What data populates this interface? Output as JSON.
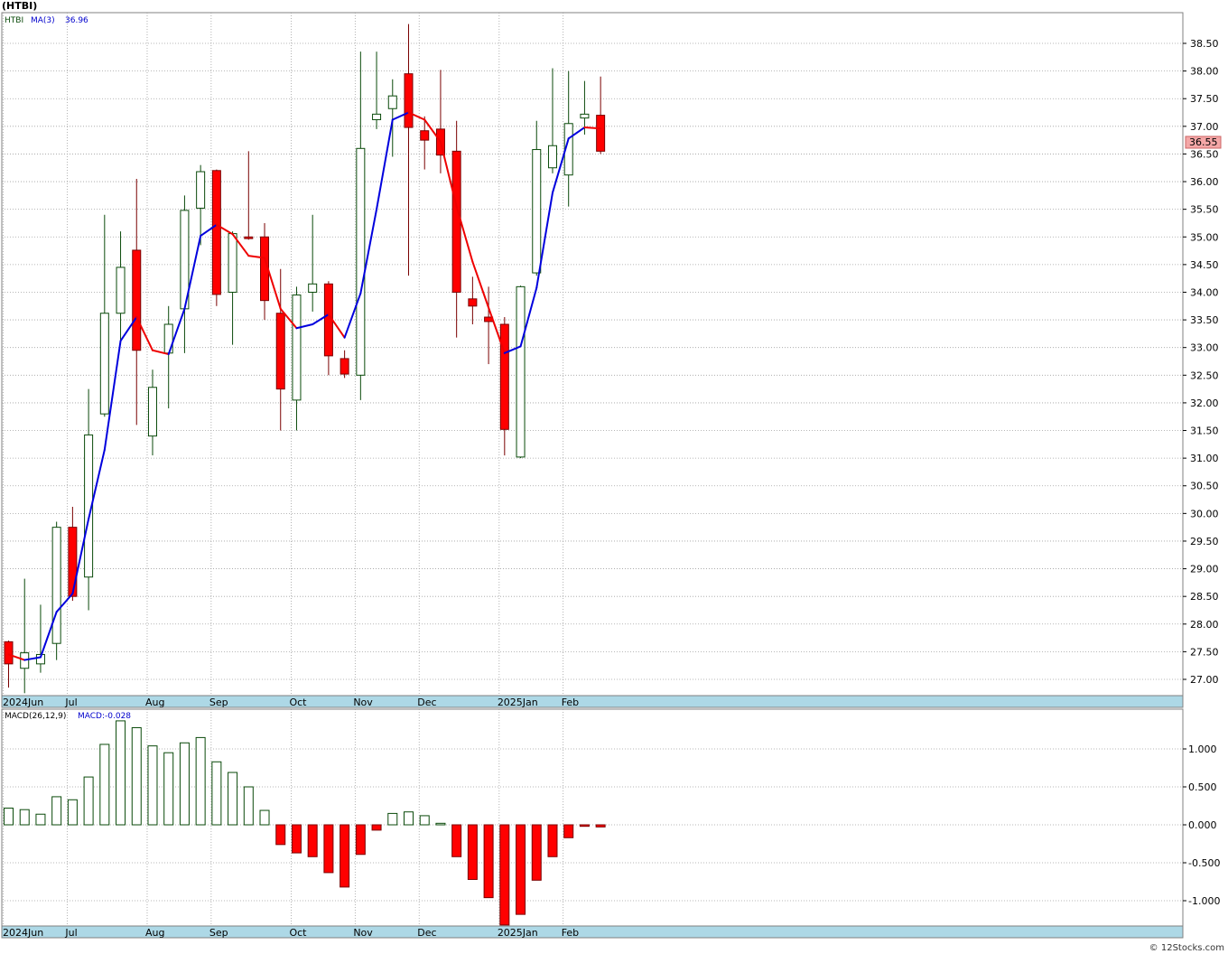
{
  "header": {
    "title": "(HTBI)"
  },
  "footer": {
    "credit": "© 12Stocks.com"
  },
  "colors": {
    "up_fill": "#ffffff",
    "up_stroke": "#0a4a0a",
    "down_fill": "#ff0000",
    "down_stroke": "#7a0000",
    "ma_up": "#0000dd",
    "ma_down": "#ee0000",
    "grid": "#a0a0a0",
    "axis_band": "#add8e6",
    "last_price_bg": "#f4a7a7"
  },
  "chart_data": [
    {
      "type": "candlestick",
      "title": "",
      "legend": {
        "symbol": "HTBI",
        "ma_label": "MA(3)",
        "ma_value": "36.96"
      },
      "y_ticks": [
        "27.00",
        "27.50",
        "28.00",
        "28.50",
        "29.00",
        "29.50",
        "30.00",
        "30.50",
        "31.00",
        "31.50",
        "32.00",
        "32.50",
        "33.00",
        "33.50",
        "34.00",
        "34.50",
        "35.00",
        "35.50",
        "36.00",
        "36.50",
        "37.00",
        "37.50",
        "38.00",
        "38.50"
      ],
      "ylim": [
        26.7,
        39.2
      ],
      "last_price_label": "36.55",
      "x_labels": [
        {
          "label": "2024Jun",
          "index": 0
        },
        {
          "label": "Jul",
          "index": 4
        },
        {
          "label": "Aug",
          "index": 9
        },
        {
          "label": "Sep",
          "index": 13
        },
        {
          "label": "Oct",
          "index": 18
        },
        {
          "label": "Nov",
          "index": 22
        },
        {
          "label": "Dec",
          "index": 26
        },
        {
          "label": "2025Jan",
          "index": 31
        },
        {
          "label": "Feb",
          "index": 35
        }
      ],
      "candles": [
        {
          "o": 27.68,
          "h": 27.7,
          "l": 26.85,
          "c": 27.28
        },
        {
          "o": 27.2,
          "h": 28.82,
          "l": 26.75,
          "c": 27.48
        },
        {
          "o": 27.28,
          "h": 28.35,
          "l": 27.12,
          "c": 27.45
        },
        {
          "o": 27.65,
          "h": 29.85,
          "l": 27.35,
          "c": 29.75
        },
        {
          "o": 29.75,
          "h": 30.12,
          "l": 28.42,
          "c": 28.5
        },
        {
          "o": 28.85,
          "h": 32.25,
          "l": 28.25,
          "c": 31.42
        },
        {
          "o": 31.8,
          "h": 35.4,
          "l": 31.75,
          "c": 33.62
        },
        {
          "o": 33.62,
          "h": 35.1,
          "l": 33.05,
          "c": 34.45
        },
        {
          "o": 34.76,
          "h": 36.05,
          "l": 31.6,
          "c": 32.95
        },
        {
          "o": 31.4,
          "h": 32.6,
          "l": 31.05,
          "c": 32.28
        },
        {
          "o": 32.9,
          "h": 33.75,
          "l": 31.9,
          "c": 33.42
        },
        {
          "o": 33.7,
          "h": 35.75,
          "l": 32.9,
          "c": 35.48
        },
        {
          "o": 35.52,
          "h": 36.3,
          "l": 34.85,
          "c": 36.18
        },
        {
          "o": 36.2,
          "h": 36.22,
          "l": 33.75,
          "c": 33.96
        },
        {
          "o": 34.0,
          "h": 35.1,
          "l": 33.05,
          "c": 35.06
        },
        {
          "o": 35.0,
          "h": 36.55,
          "l": 34.95,
          "c": 34.97
        },
        {
          "o": 35.0,
          "h": 35.25,
          "l": 33.5,
          "c": 33.85
        },
        {
          "o": 33.62,
          "h": 34.42,
          "l": 31.5,
          "c": 32.25
        },
        {
          "o": 32.05,
          "h": 34.1,
          "l": 31.5,
          "c": 33.95
        },
        {
          "o": 34.0,
          "h": 35.4,
          "l": 33.65,
          "c": 34.15
        },
        {
          "o": 34.15,
          "h": 34.2,
          "l": 32.5,
          "c": 32.85
        },
        {
          "o": 32.8,
          "h": 32.95,
          "l": 32.45,
          "c": 32.52
        },
        {
          "o": 32.5,
          "h": 38.35,
          "l": 32.05,
          "c": 36.6
        },
        {
          "o": 37.12,
          "h": 38.35,
          "l": 36.95,
          "c": 37.22
        },
        {
          "o": 37.32,
          "h": 37.85,
          "l": 36.45,
          "c": 37.55
        },
        {
          "o": 37.95,
          "h": 38.85,
          "l": 34.3,
          "c": 36.98
        },
        {
          "o": 36.92,
          "h": 37.18,
          "l": 36.22,
          "c": 36.75
        },
        {
          "o": 36.95,
          "h": 38.02,
          "l": 36.15,
          "c": 36.48
        },
        {
          "o": 36.55,
          "h": 37.1,
          "l": 33.18,
          "c": 34.0
        },
        {
          "o": 33.88,
          "h": 34.28,
          "l": 33.42,
          "c": 33.75
        },
        {
          "o": 33.55,
          "h": 34.1,
          "l": 32.7,
          "c": 33.47
        },
        {
          "o": 33.42,
          "h": 33.55,
          "l": 31.05,
          "c": 31.52
        },
        {
          "o": 31.02,
          "h": 34.12,
          "l": 31.0,
          "c": 34.1
        },
        {
          "o": 34.35,
          "h": 37.1,
          "l": 34.3,
          "c": 36.58
        },
        {
          "o": 36.25,
          "h": 38.05,
          "l": 36.15,
          "c": 36.65
        },
        {
          "o": 36.12,
          "h": 38.0,
          "l": 35.55,
          "c": 37.05
        },
        {
          "o": 37.15,
          "h": 37.82,
          "l": 36.85,
          "c": 37.22
        },
        {
          "o": 37.2,
          "h": 37.9,
          "l": 36.5,
          "c": 36.55
        }
      ],
      "ma": [
        27.45,
        27.35,
        27.4,
        28.22,
        28.55,
        29.9,
        31.15,
        33.12,
        33.55,
        32.95,
        32.88,
        33.7,
        35.02,
        35.22,
        35.05,
        34.66,
        34.62,
        33.7,
        33.35,
        33.42,
        33.6,
        33.18,
        33.98,
        35.5,
        37.12,
        37.25,
        37.12,
        36.72,
        35.55,
        34.55,
        33.72,
        32.9,
        33.02,
        34.08,
        35.8,
        36.78,
        36.98,
        36.96
      ]
    },
    {
      "type": "bar",
      "title": "",
      "legend": {
        "label": "MACD(26,12,9)",
        "value_label": "MACD:-0.028"
      },
      "y_ticks": [
        "1.000",
        "0.500",
        "0.000",
        "-0.500",
        "-1.000"
      ],
      "ylim": [
        -1.35,
        1.45
      ],
      "values": [
        0.22,
        0.2,
        0.14,
        0.37,
        0.33,
        0.63,
        1.06,
        1.37,
        1.28,
        1.04,
        0.95,
        1.08,
        1.15,
        0.83,
        0.69,
        0.5,
        0.19,
        -0.26,
        -0.37,
        -0.42,
        -0.63,
        -0.82,
        -0.39,
        -0.07,
        0.15,
        0.17,
        0.12,
        0.02,
        -0.42,
        -0.72,
        -0.96,
        -1.32,
        -1.18,
        -0.73,
        -0.42,
        -0.17,
        -0.02,
        -0.028
      ],
      "x_labels": [
        {
          "label": "2024Jun",
          "index": 0
        },
        {
          "label": "Jul",
          "index": 4
        },
        {
          "label": "Aug",
          "index": 9
        },
        {
          "label": "Sep",
          "index": 13
        },
        {
          "label": "Oct",
          "index": 18
        },
        {
          "label": "Nov",
          "index": 22
        },
        {
          "label": "Dec",
          "index": 26
        },
        {
          "label": "2025Jan",
          "index": 31
        },
        {
          "label": "Feb",
          "index": 35
        }
      ]
    }
  ]
}
